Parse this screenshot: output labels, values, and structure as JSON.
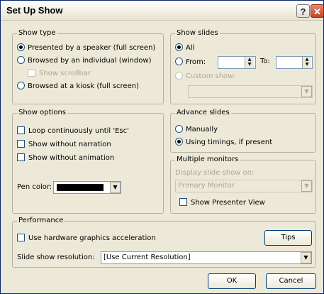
{
  "window": {
    "title": "Set Up Show",
    "help_label": "?",
    "close_label": "✕"
  },
  "show_type": {
    "legend": "Show type",
    "presented": "Presented by a speaker (full screen)",
    "browsed_individual": "Browsed by an individual (window)",
    "show_scrollbar": "Show scrollbar",
    "browsed_kiosk": "Browsed at a kiosk (full screen)"
  },
  "show_slides": {
    "legend": "Show slides",
    "all": "All",
    "from": "From:",
    "to": "To:",
    "from_value": "",
    "to_value": "",
    "custom_show": "Custom show:",
    "custom_show_value": ""
  },
  "show_options": {
    "legend": "Show options",
    "loop": "Loop continuously until 'Esc'",
    "without_narration": "Show without narration",
    "without_animation": "Show without animation",
    "pen_color": "Pen color:",
    "pen_color_value": "#000000"
  },
  "advance_slides": {
    "legend": "Advance slides",
    "manually": "Manually",
    "using_timings": "Using timings, if present"
  },
  "multiple_monitors": {
    "legend": "Multiple monitors",
    "display_on": "Display slide show on:",
    "monitor_value": "Primary Monitor",
    "presenter_view": "Show Presenter View"
  },
  "performance": {
    "legend": "Performance",
    "hardware_accel": "Use hardware graphics acceleration",
    "tips": "Tips",
    "resolution_label": "Slide show resolution:",
    "resolution_value": "[Use Current Resolution]"
  },
  "footer": {
    "ok": "OK",
    "cancel": "Cancel"
  }
}
